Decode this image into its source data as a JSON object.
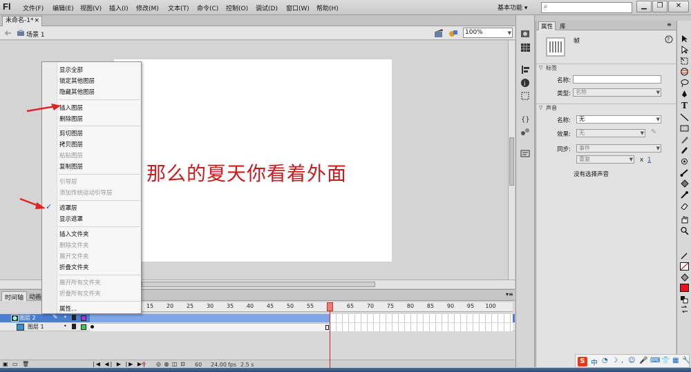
{
  "app": {
    "logo": "Fl",
    "menus": [
      "文件(F)",
      "编辑(E)",
      "视图(V)",
      "插入(I)",
      "修改(M)",
      "文本(T)",
      "命令(C)",
      "控制(O)",
      "调试(D)",
      "窗口(W)",
      "帮助(H)"
    ],
    "workspace_label": "基本功能 ▾",
    "search_placeholder": ""
  },
  "document": {
    "tab_label": "未命名-1*",
    "tab_close": "×",
    "scene_label": "场景 1",
    "zoom": "100%"
  },
  "stage": {
    "text": "那么的夏天你看着外面",
    "text_color": "#cc1b1b"
  },
  "context_menu": {
    "items": [
      {
        "label": "显示全部",
        "enabled": true
      },
      {
        "label": "锁定其他图层",
        "enabled": true
      },
      {
        "label": "隐藏其他图层",
        "enabled": true
      },
      {
        "label": "插入图层",
        "enabled": true
      },
      {
        "label": "删除图层",
        "enabled": true
      },
      {
        "label": "剪切图层",
        "enabled": true
      },
      {
        "label": "拷贝图层",
        "enabled": true
      },
      {
        "label": "粘贴图层",
        "enabled": false
      },
      {
        "label": "复制图层",
        "enabled": true
      },
      {
        "label": "引导层",
        "enabled": false
      },
      {
        "label": "添加传统运动引导层",
        "enabled": false
      },
      {
        "label": "遮罩层",
        "enabled": true,
        "checked": true
      },
      {
        "label": "显示遮罩",
        "enabled": true
      },
      {
        "label": "插入文件夹",
        "enabled": true
      },
      {
        "label": "删除文件夹",
        "enabled": false
      },
      {
        "label": "展开文件夹",
        "enabled": false
      },
      {
        "label": "折叠文件夹",
        "enabled": true
      },
      {
        "label": "展开所有文件夹",
        "enabled": false
      },
      {
        "label": "折叠所有文件夹",
        "enabled": false
      },
      {
        "label": "属性...",
        "enabled": true
      }
    ],
    "check_mark": "✓"
  },
  "timeline": {
    "tabs": [
      "时间轴",
      "动画"
    ],
    "ruler_numbers": [
      "15",
      "20",
      "25",
      "30",
      "35",
      "40",
      "45",
      "50",
      "55",
      "60",
      "65",
      "70",
      "75",
      "80",
      "85",
      "90",
      "95",
      "100"
    ],
    "layers": [
      {
        "name": "图层 2",
        "selected": true
      },
      {
        "name": "图层 1",
        "selected": false
      }
    ],
    "current_frame": "60",
    "frame_rate": "24.00",
    "fps_label": "fps",
    "elapsed": "2.5 s"
  },
  "properties": {
    "tabs": [
      "属性",
      "库"
    ],
    "object_type": "帧",
    "sections": {
      "label": {
        "title": "标签",
        "name_label": "名称:",
        "name_value": "",
        "type_label": "类型:",
        "type_value": "名称"
      },
      "sound": {
        "title": "声音",
        "name_label": "名称:",
        "name_value": "无",
        "effect_label": "效果:",
        "effect_value": "无",
        "sync_label": "同步:",
        "sync_value": "事件",
        "repeat_value": "重复",
        "repeat_times_prefix": "x",
        "repeat_times": "1",
        "no_sound_text": "没有选择声音"
      }
    }
  },
  "tray": {
    "ime_label": "中"
  }
}
